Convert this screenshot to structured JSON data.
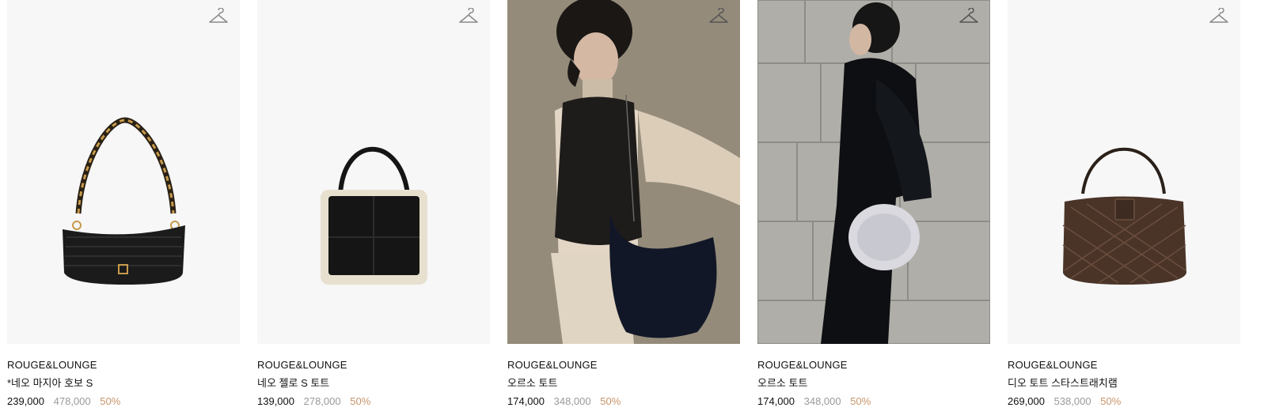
{
  "colors": {
    "discount": "#c8956b",
    "original_price": "#9a9a9a",
    "text": "#111111",
    "thumb_bg": "#f7f7f7"
  },
  "products": [
    {
      "brand": "ROUGE&LOUNGE",
      "name": "*네오 마지아 호보 S",
      "price": "239,000",
      "original_price": "478,000",
      "discount": "50%",
      "icon": "hanger-icon"
    },
    {
      "brand": "ROUGE&LOUNGE",
      "name": "네오 젤로 S 토트",
      "price": "139,000",
      "original_price": "278,000",
      "discount": "50%",
      "icon": "hanger-icon"
    },
    {
      "brand": "ROUGE&LOUNGE",
      "name": "오르소 토트",
      "price": "174,000",
      "original_price": "348,000",
      "discount": "50%",
      "icon": "hanger-icon"
    },
    {
      "brand": "ROUGE&LOUNGE",
      "name": "오르소 토트",
      "price": "174,000",
      "original_price": "348,000",
      "discount": "50%",
      "icon": "hanger-icon"
    },
    {
      "brand": "ROUGE&LOUNGE",
      "name": "디오 토트 스타스트래치램",
      "price": "269,000",
      "original_price": "538,000",
      "discount": "50%",
      "icon": "hanger-icon"
    }
  ]
}
